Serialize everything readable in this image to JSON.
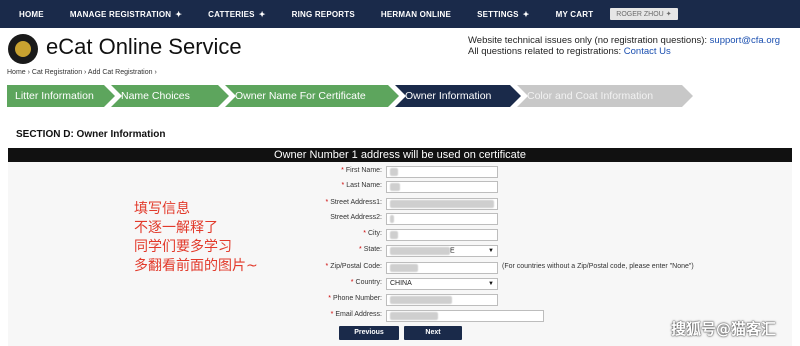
{
  "nav": {
    "items": [
      {
        "label": "HOME",
        "arrow": ""
      },
      {
        "label": "MANAGE REGISTRATION",
        "arrow": "✦"
      },
      {
        "label": "CATTERIES",
        "arrow": "✦"
      },
      {
        "label": "RING REPORTS",
        "arrow": ""
      },
      {
        "label": "HERMAN ONLINE",
        "arrow": ""
      },
      {
        "label": "SETTINGS",
        "arrow": "✦"
      },
      {
        "label": "MY CART",
        "arrow": ""
      }
    ],
    "user": "ROGER ZHOU",
    "user_arrow": "✦"
  },
  "header": {
    "title": "eCat Online Service",
    "contact_line1": "Website technical issues only (no registration questions):",
    "contact_email": "support@cfa.org",
    "contact_line2": "All questions related to registrations:",
    "contact_link": "Contact Us"
  },
  "breadcrumb": "Home › Cat Registration › Add Cat Registration ›",
  "steps": [
    {
      "label": "Litter Information",
      "state": "done"
    },
    {
      "label": "Name Choices",
      "state": "done"
    },
    {
      "label": "Owner Name For Certificate",
      "state": "done"
    },
    {
      "label": "Owner Information",
      "state": "active"
    },
    {
      "label": "Color and Coat Information",
      "state": "todo"
    }
  ],
  "section": {
    "title": "SECTION D: Owner Information",
    "banner": "Owner Number 1 address will be used on certificate"
  },
  "form": {
    "first_name": {
      "label": "First Name:",
      "value": ""
    },
    "last_name": {
      "label": "Last Name:",
      "value": ""
    },
    "street1": {
      "label": "Street Address1:",
      "value": ""
    },
    "street2": {
      "label": "Street Address2:",
      "value": ""
    },
    "city": {
      "label": "City:",
      "value": ""
    },
    "state": {
      "label": "State:",
      "value": "E"
    },
    "zip": {
      "label": "Zip/Postal Code:",
      "value": "",
      "hint": "(For countries without a Zip/Postal code, please enter \"None\")"
    },
    "country": {
      "label": "Country:",
      "value": "CHINA"
    },
    "phone": {
      "label": "Phone Number:",
      "value": ""
    },
    "email": {
      "label": "Email Address:",
      "value": ""
    }
  },
  "buttons": {
    "previous": "Previous",
    "next": "Next"
  },
  "overlay_note": [
    "填写信息",
    "不逐一解释了",
    "同学们要多学习",
    "多翻看前面的图片~"
  ],
  "watermark": "搜狐号@猫客汇",
  "colors": {
    "nav_bg": "#1a2a4a",
    "step_done": "#5da55d",
    "step_active": "#1a2a4a",
    "step_todo": "#c8c8c8",
    "note_red": "#e23a2b"
  }
}
